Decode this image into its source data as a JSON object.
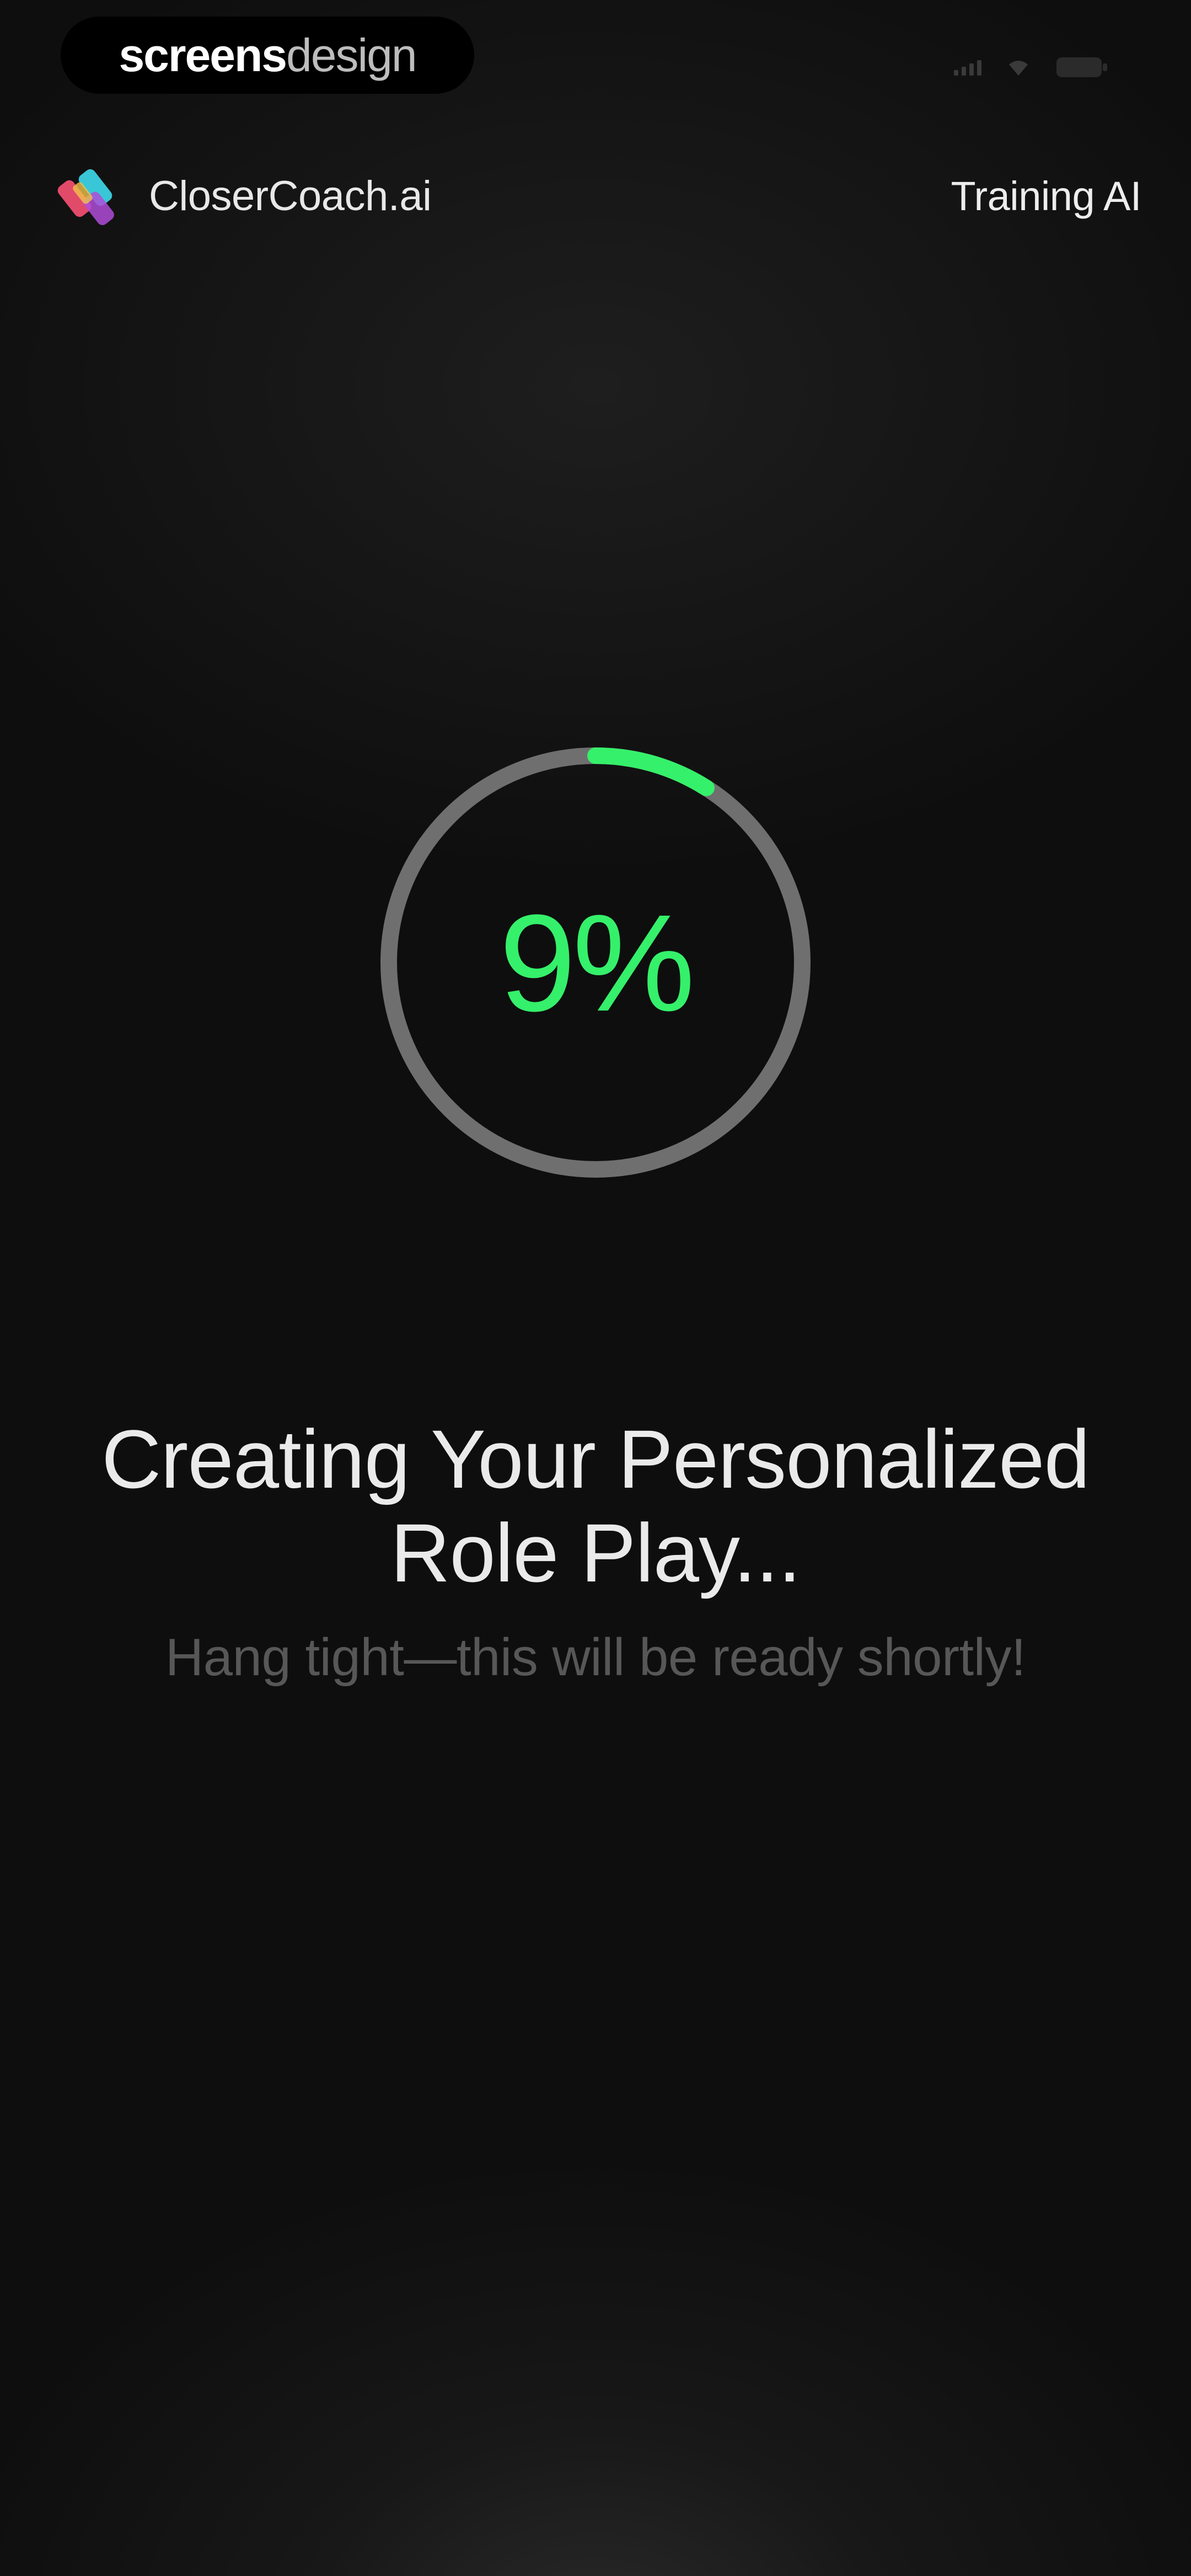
{
  "status_bar": {
    "brand_part1": "screens",
    "brand_part2": "design",
    "icons": [
      "signal-icon",
      "wifi-icon",
      "battery-icon"
    ]
  },
  "header": {
    "logo_text": "CloserCoach.ai",
    "right_link": "Training AI"
  },
  "progress": {
    "percent_label": "9%",
    "fraction": 0.09,
    "color_active": "#35f06a",
    "color_track": "#6f6f6f"
  },
  "content": {
    "title_line1": "Creating Your Personalized",
    "title_line2": "Role Play...",
    "subtitle": "Hang tight—this will be ready shortly!"
  },
  "colors": {
    "background": "#0f0f0f",
    "accent": "#35f06a"
  }
}
